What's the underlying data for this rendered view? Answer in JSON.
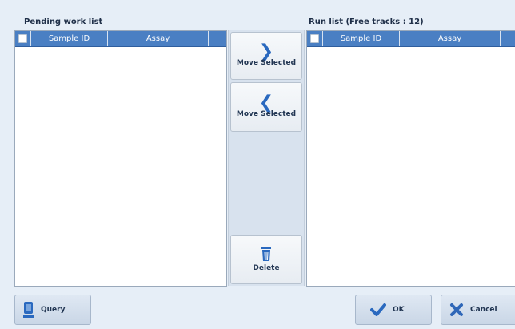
{
  "pending": {
    "title": "Pending work list",
    "columns": [
      "Sample ID",
      "Assay"
    ]
  },
  "run": {
    "title": "Run list (Free tracks : 12)",
    "columns": [
      "Sample ID",
      "Assay"
    ]
  },
  "middle": {
    "move_right_label": "Move Selected",
    "move_left_label": "Move Selected",
    "delete_label": "Delete"
  },
  "footer": {
    "query_label": "Query",
    "ok_label": "OK",
    "cancel_label": "Cancel"
  },
  "colors": {
    "header_blue": "#4a7fc3",
    "accent_blue": "#2a69bf",
    "cancel_icon_blue": "#2f67b8"
  },
  "icons": {
    "move_right": "chevron-right-icon",
    "move_left": "chevron-left-icon",
    "delete": "trash-icon",
    "query": "query-person-icon",
    "ok": "check-icon",
    "cancel": "x-icon"
  }
}
